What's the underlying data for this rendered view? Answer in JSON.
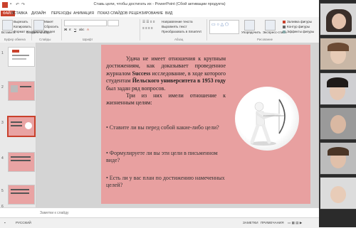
{
  "window": {
    "title": "Ставь цели, чтобы достигать их - PowerPoint (Сбой активации продукта)"
  },
  "tabs": [
    "ФАЙЛ",
    "ВСТАВКА",
    "ДИЗАЙН",
    "ПЕРЕХОДЫ",
    "АНИМАЦИЯ",
    "ПОКАЗ СЛАЙДОВ",
    "РЕЦЕНЗИРОВАНИЕ",
    "ВИД"
  ],
  "ribbon": {
    "paste": "Вставить",
    "cut": "Вырезать",
    "copy": "Копировать",
    "format_painter": "Формат по образцу",
    "clipboard_group": "Буфер обмена",
    "new_slide": "Создать слайд",
    "layout": "Макет",
    "reset": "Сбросить",
    "section": "Раздел",
    "slides_group": "Слайды",
    "font_group": "Шрифт",
    "text_direction": "Направление текста",
    "align_text": "Выровнять текст",
    "smartart": "Преобразовать в SmartArt",
    "paragraph_group": "Абзац",
    "arrange": "Упорядочить",
    "quick_styles": "Экспресс-стили",
    "shape_fill": "Заливка фигуры",
    "shape_outline": "Контур фигуры",
    "shape_effects": "Эффекты фигуры",
    "drawing_group": "Рисование"
  },
  "slide_numbers": [
    "1",
    "2",
    "3",
    "4",
    "5",
    "6"
  ],
  "slide": {
    "p1_a": "Удача не имеет отношения к крупным достижениям, как доказывает проведенное журналом ",
    "p1_success": "Success",
    "p1_b": " исследование, в ходе которого студентам ",
    "p1_univ": "Йельского университета в 1953 году",
    "p1_c": " был задан ряд вопросов.",
    "p2": "Три из них имели отношение к жизненным целям:",
    "bullet1": "• Ставите ли вы перед собой какие-либо цели?",
    "bullet2": "• Формулируете ли вы эти цели в письменном виде?",
    "bullet3": "• Есть ли у вас план по достижению намеченных целей?"
  },
  "notes": {
    "placeholder": "Заметки к слайду"
  },
  "status": {
    "language": "РУССКИЙ",
    "notes_btn": "ЗАМЕТКИ",
    "comments_btn": "ПРИМЕЧАНИЯ"
  },
  "colors": {
    "slide_bg": "#e8a0a0",
    "accent": "#c9412c"
  }
}
